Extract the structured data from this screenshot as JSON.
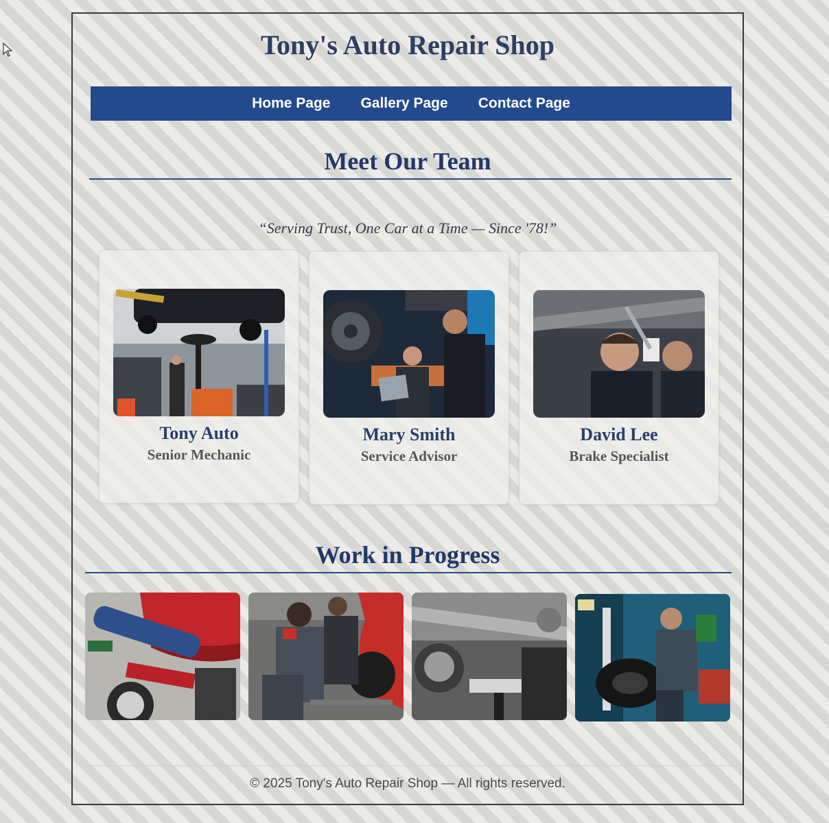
{
  "site": {
    "title": "Tony's Auto Repair Shop"
  },
  "nav": {
    "items": [
      {
        "label": "Home Page"
      },
      {
        "label": "Gallery Page"
      },
      {
        "label": "Contact Page"
      }
    ]
  },
  "team_section": {
    "heading": "Meet Our Team",
    "tagline": "“Serving Trust, One Car at a Time — Since '78!”",
    "members": [
      {
        "name": "Tony Auto",
        "role": "Senior Mechanic"
      },
      {
        "name": "Mary Smith",
        "role": "Service Advisor"
      },
      {
        "name": "David Lee",
        "role": "Brake Specialist"
      }
    ]
  },
  "work_section": {
    "heading": "Work in Progress"
  },
  "footer": {
    "text": "© 2025 Tony's Auto Repair Shop — All rights reserved."
  },
  "colors": {
    "nav_background": "#234a8c",
    "heading_text": "#2e3e64",
    "rule": "#284a86"
  }
}
